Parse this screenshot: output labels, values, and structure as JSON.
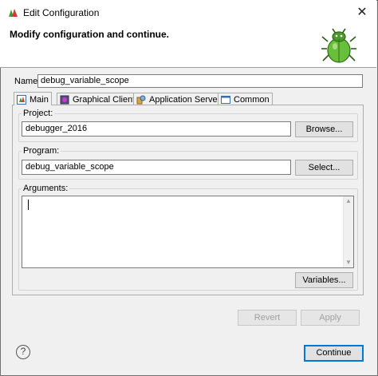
{
  "window": {
    "title": "Edit Configuration",
    "close_glyph": "✕"
  },
  "header": {
    "message": "Modify configuration and continue."
  },
  "name": {
    "label": "Name:",
    "value": "debug_variable_scope"
  },
  "tabs": [
    {
      "label": "Main",
      "icon": "main-tab-icon",
      "active": true
    },
    {
      "label": "Graphical Clients",
      "icon": "graphical-clients-icon",
      "active": false
    },
    {
      "label": "Application Servers",
      "icon": "application-servers-icon",
      "active": false
    },
    {
      "label": "Common",
      "icon": "common-icon",
      "active": false
    }
  ],
  "main": {
    "project": {
      "label": "Project:",
      "value": "debugger_2016",
      "button": "Browse..."
    },
    "program": {
      "label": "Program:",
      "value": "debug_variable_scope",
      "button": "Select..."
    },
    "arguments": {
      "label": "Arguments:",
      "value": "",
      "button": "Variables..."
    }
  },
  "actions": {
    "revert": "Revert",
    "apply": "Apply",
    "continue": "Continue",
    "help": "?"
  },
  "colors": {
    "accent": "#0078d7",
    "background": "#f0f0f0"
  }
}
